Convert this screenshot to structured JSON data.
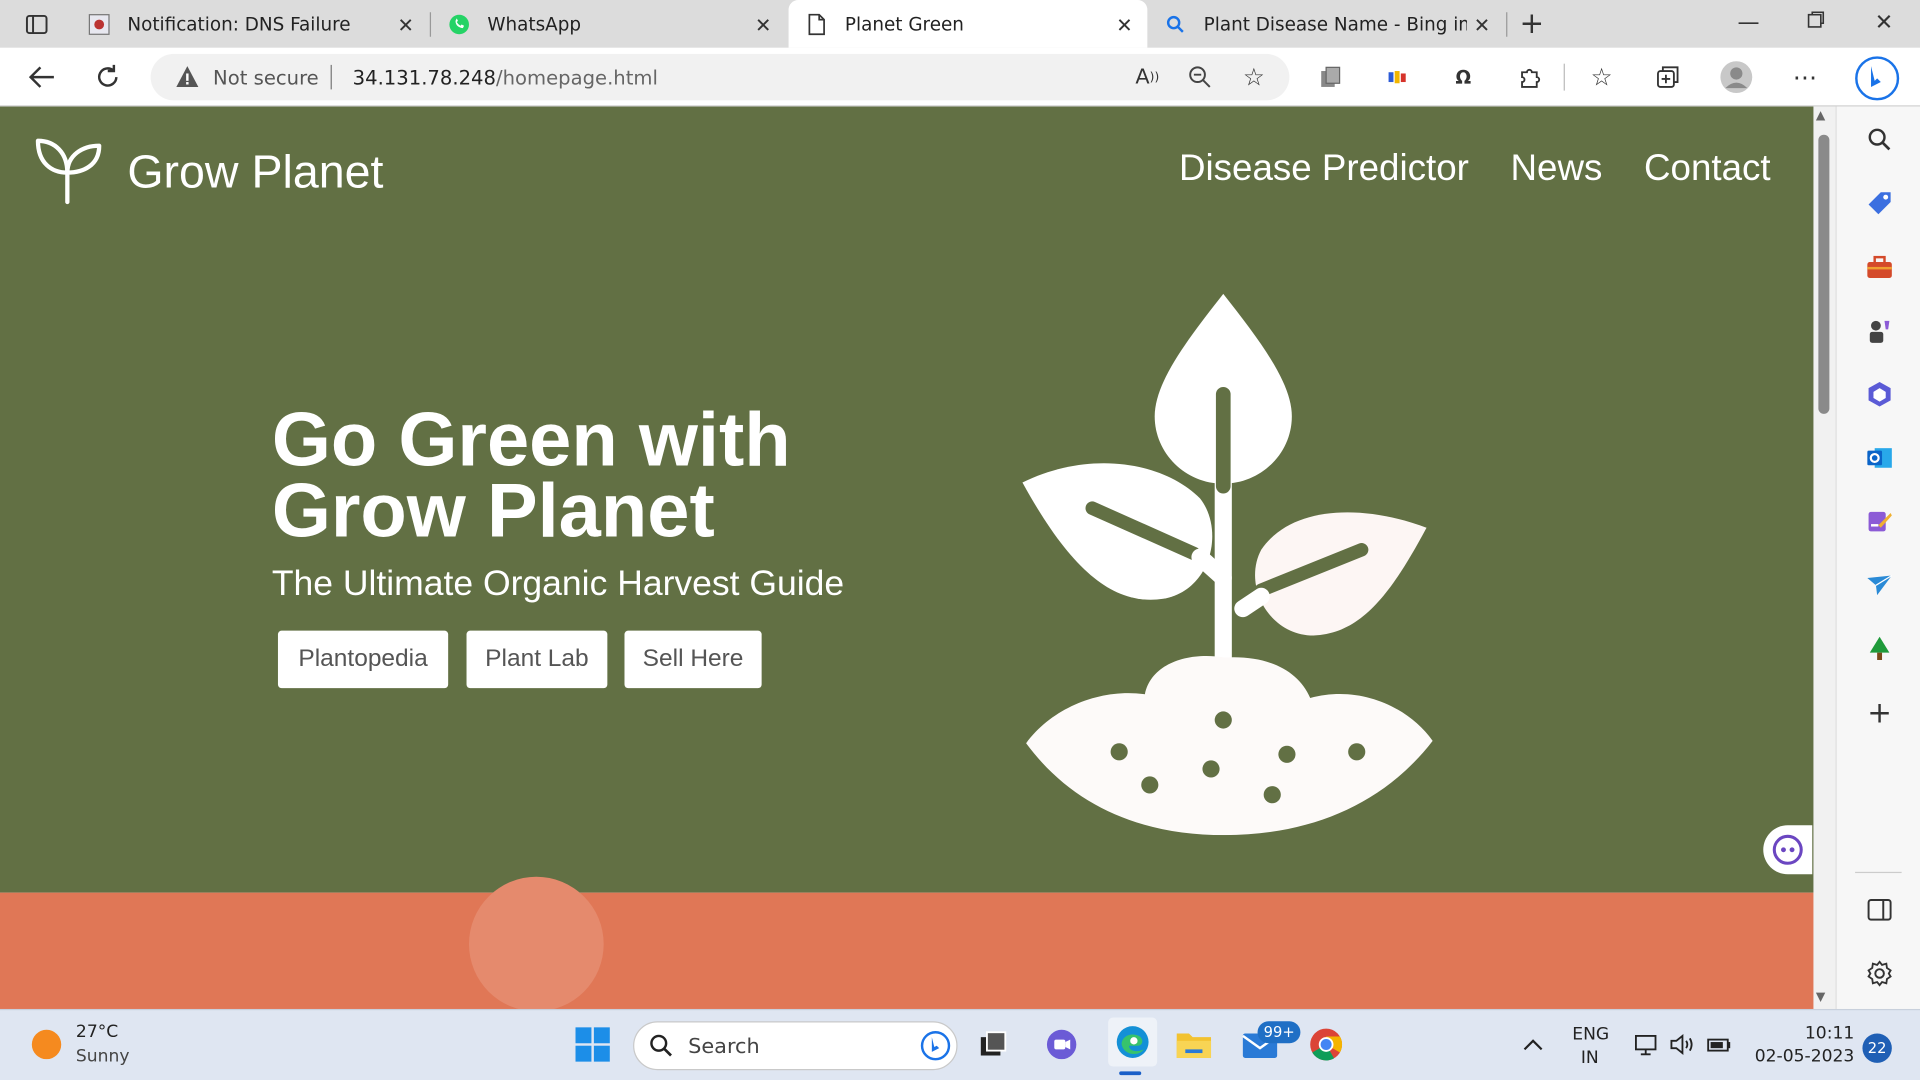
{
  "browser": {
    "tabs": [
      {
        "title": "Notification: DNS Failure",
        "icon": "dns-failure-favicon"
      },
      {
        "title": "WhatsApp",
        "icon": "whatsapp-favicon"
      },
      {
        "title": "Planet Green",
        "icon": "page-favicon",
        "active": true
      },
      {
        "title": "Plant Disease Name - Bing image",
        "icon": "bing-search-favicon"
      }
    ],
    "address": {
      "security_label": "Not secure",
      "host": "34.131.78.248",
      "path": "/homepage.html"
    }
  },
  "site": {
    "brand": "Grow Planet",
    "nav": [
      "Disease Predictor",
      "News",
      "Contact"
    ],
    "hero": {
      "headline_line1": "Go Green with",
      "headline_line2": "Grow Planet",
      "subtitle": "The Ultimate Organic Harvest Guide",
      "buttons": [
        "Plantopedia",
        "Plant Lab",
        "Sell Here"
      ]
    },
    "colors": {
      "hero_bg": "#627044",
      "section_bg": "#e07756"
    }
  },
  "taskbar": {
    "weather_temp": "27°C",
    "weather_cond": "Sunny",
    "search_placeholder": "Search",
    "mail_badge": "99+",
    "lang_line1": "ENG",
    "lang_line2": "IN",
    "time": "10:11",
    "date": "02-05-2023",
    "notifications": "22"
  }
}
